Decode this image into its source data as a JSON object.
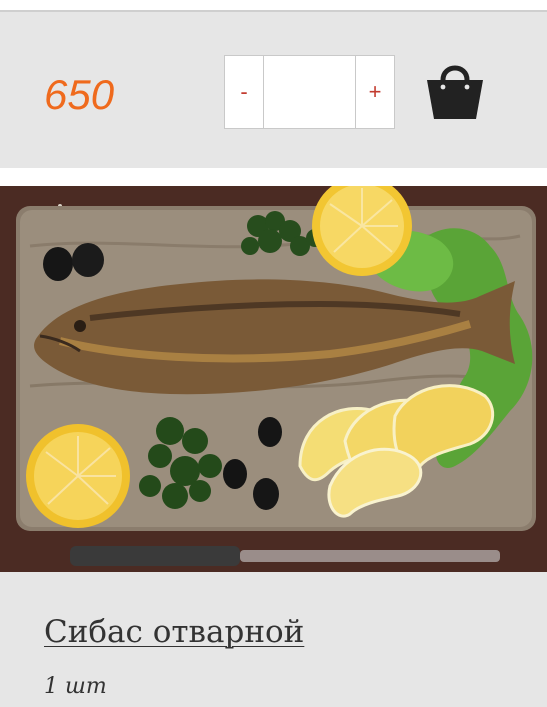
{
  "product": {
    "price": "650",
    "quantity_minus": "-",
    "quantity_plus": "+",
    "quantity_value": "",
    "title": "Сибас отварной",
    "unit": "1 шт"
  },
  "icons": {
    "cart": "shopping-bag-icon"
  },
  "colors": {
    "price": "#ef6a1d",
    "stepper": "#c23b2f",
    "panel": "#e6e6e6",
    "text": "#333333"
  }
}
